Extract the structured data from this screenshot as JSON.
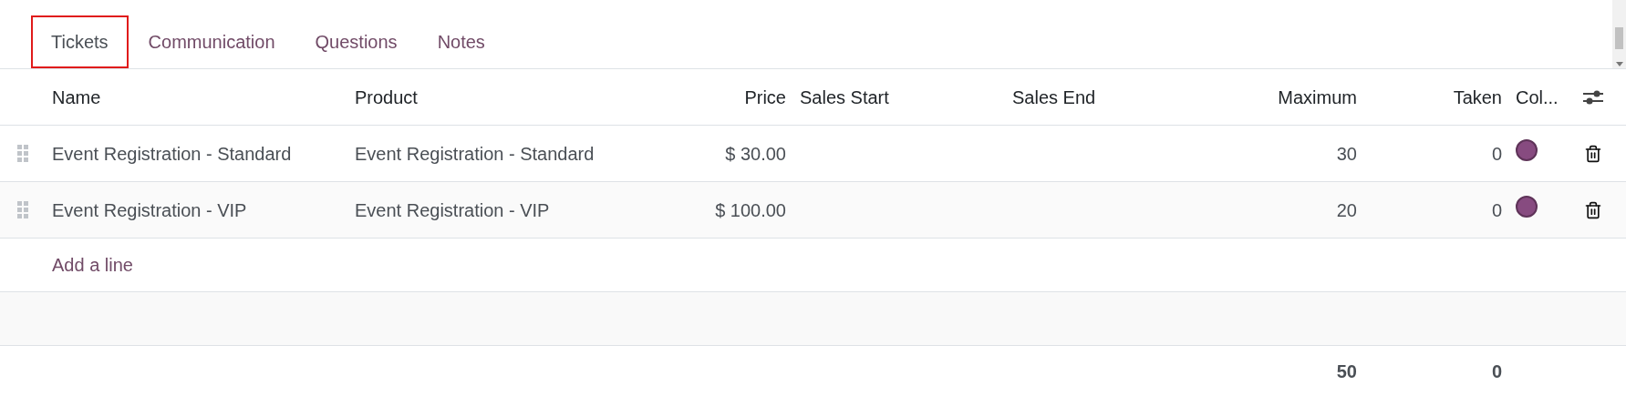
{
  "tabs": [
    {
      "label": "Tickets",
      "selected": true
    },
    {
      "label": "Communication",
      "selected": false
    },
    {
      "label": "Questions",
      "selected": false
    },
    {
      "label": "Notes",
      "selected": false
    }
  ],
  "table": {
    "columns": [
      {
        "label": "Name"
      },
      {
        "label": "Product"
      },
      {
        "label": "Price"
      },
      {
        "label": "Sales Start"
      },
      {
        "label": "Sales End"
      },
      {
        "label": "Maximum"
      },
      {
        "label": "Taken"
      },
      {
        "label": "Col..."
      }
    ],
    "rows": [
      {
        "name": "Event Registration - Standard",
        "product": "Event Registration - Standard",
        "price": "$ 30.00",
        "maximum": "30",
        "taken": "0",
        "color": "#874b80"
      },
      {
        "name": "Event Registration - VIP",
        "product": "Event Registration - VIP",
        "price": "$ 100.00",
        "maximum": "20",
        "taken": "0",
        "color": "#874b80"
      }
    ],
    "add_line": "Add a line",
    "totals": {
      "maximum": "50",
      "taken": "0"
    }
  }
}
